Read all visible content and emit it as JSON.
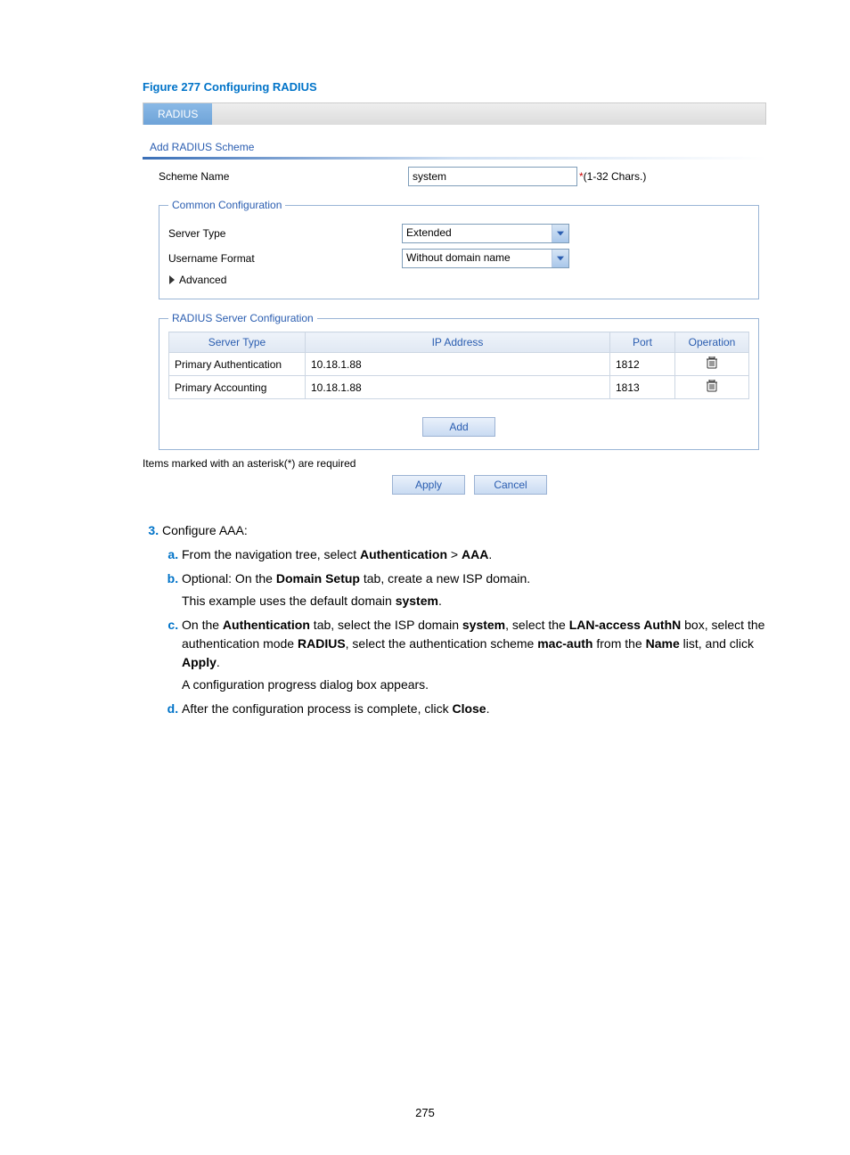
{
  "figure_caption": "Figure 277 Configuring RADIUS",
  "tab_label": "RADIUS",
  "section_title": "Add RADIUS Scheme",
  "scheme_name": {
    "label": "Scheme Name",
    "value": "system",
    "hint": "(1-32 Chars.)"
  },
  "common": {
    "legend": "Common Configuration",
    "server_type": {
      "label": "Server Type",
      "value": "Extended"
    },
    "username_format": {
      "label": "Username Format",
      "value": "Without domain name"
    },
    "advanced_label": "Advanced"
  },
  "radius_servers": {
    "legend": "RADIUS Server Configuration",
    "headers": {
      "type": "Server Type",
      "ip": "IP Address",
      "port": "Port",
      "op": "Operation"
    },
    "rows": [
      {
        "type": "Primary Authentication",
        "ip": "10.18.1.88",
        "port": "1812"
      },
      {
        "type": "Primary Accounting",
        "ip": "10.18.1.88",
        "port": "1813"
      }
    ],
    "add_button": "Add"
  },
  "required_note": "Items marked with an asterisk(*) are required",
  "buttons": {
    "apply": "Apply",
    "cancel": "Cancel"
  },
  "steps": {
    "num3_label": "Configure AAA:",
    "a": {
      "pre": "From the navigation tree, select ",
      "auth": "Authentication",
      "sep": " > ",
      "aaa": "AAA",
      "post": "."
    },
    "b": {
      "pre": "Optional: On the ",
      "tab": "Domain Setup",
      "mid": " tab, create a new ISP domain.",
      "note_pre": "This example uses the default domain ",
      "note_b": "system",
      "note_post": "."
    },
    "c": {
      "pre": "On the ",
      "tab": "Authentication",
      "s1": " tab, select the ISP domain ",
      "system": "system",
      "s2": ", select the ",
      "lan": "LAN-access AuthN",
      "s3": " box, select the authentication mode ",
      "radius": "RADIUS",
      "s4": ", select the authentication scheme ",
      "mac": "mac-auth",
      "s5": " from the ",
      "name": "Name",
      "s6": " list, and click ",
      "apply": "Apply",
      "s7": ".",
      "note": "A configuration progress dialog box appears."
    },
    "d": {
      "pre": "After the configuration process is complete, click ",
      "close": "Close",
      "post": "."
    }
  },
  "page_number": "275"
}
